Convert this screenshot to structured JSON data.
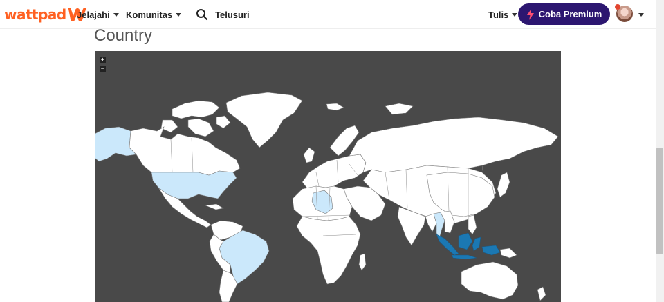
{
  "header": {
    "logo_text": "wattpad",
    "nav": [
      {
        "label": "Jelajahi"
      },
      {
        "label": "Komunitas"
      }
    ],
    "search_placeholder": "Telusuri",
    "write_label": "Tulis",
    "premium_label": "Coba Premium"
  },
  "section": {
    "title": "Country"
  },
  "map": {
    "zoom_in": "+",
    "zoom_out": "−",
    "colors": {
      "ocean": "#494949",
      "land": "#ffffff",
      "light_highlight": "#cbe8fb",
      "dark_highlight": "#1b78b3"
    },
    "highlighted_light": [
      "United States",
      "Brazil",
      "Algeria",
      "Thailand"
    ],
    "highlighted_dark": [
      "Indonesia"
    ]
  }
}
